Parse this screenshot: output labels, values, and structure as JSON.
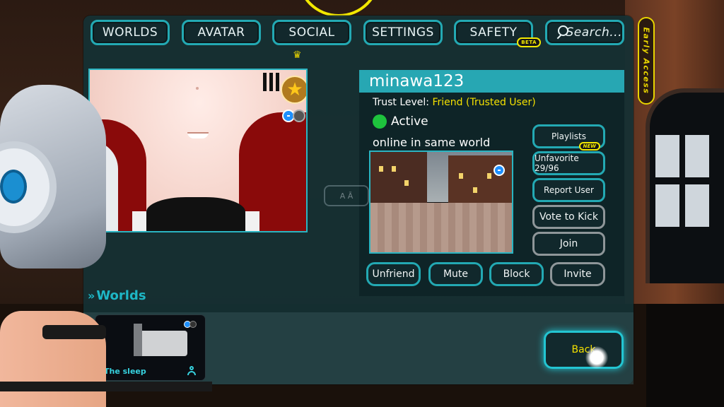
{
  "nav": {
    "worlds": "WORLDS",
    "avatar": "AVATAR",
    "social": "SOCIAL",
    "settings": "SETTINGS",
    "safety": "SAFETY",
    "safety_badge": "BETA",
    "search": "Search..."
  },
  "early_access": "Early Access",
  "user": {
    "name": "minawa123",
    "trust_label": "Trust Level:",
    "trust_value": "Friend (Trusted User)",
    "status": "Active",
    "location": "online in same world"
  },
  "side_buttons": {
    "playlists": "Playlists",
    "playlists_badge": "NEW",
    "unfavorite": "Unfavorite 29/96",
    "report": "Report User",
    "vote_kick": "Vote to Kick",
    "join": "Join"
  },
  "bottom_buttons": {
    "unfriend": "Unfriend",
    "mute": "Mute",
    "block": "Block",
    "invite": "Invite"
  },
  "worlds_section": {
    "header": "Worlds",
    "items": [
      {
        "title": "The sleep"
      }
    ]
  },
  "back": "Back",
  "faded_label": "A Ā",
  "colors": {
    "accent": "#23a9b3",
    "trust": "#f3e000",
    "status_active": "#1ec33d",
    "badge": "#f3e900"
  },
  "icons": {
    "search": "search-icon",
    "status": "status-dot-icon",
    "favorite": "star-icon",
    "mic": "mic-icon",
    "user": "user-icon",
    "worlds": "chevron-right-icon",
    "crown": "crown-icon"
  }
}
